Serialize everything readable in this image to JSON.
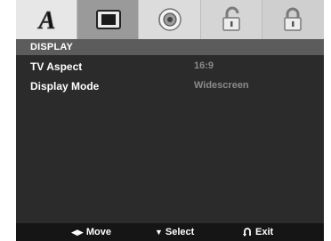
{
  "tabs": [
    {
      "label": "A",
      "icon": "language-icon",
      "active": false
    },
    {
      "label": "",
      "icon": "display-icon",
      "active": true
    },
    {
      "label": "",
      "icon": "speaker-icon",
      "active": false
    },
    {
      "label": "",
      "icon": "unlock-icon",
      "active": false
    },
    {
      "label": "",
      "icon": "lock-icon",
      "active": false
    }
  ],
  "section": {
    "title": "DISPLAY"
  },
  "settings": [
    {
      "label": "TV Aspect",
      "value": "16:9"
    },
    {
      "label": "Display Mode",
      "value": "Widescreen"
    }
  ],
  "footer": {
    "move_icon": "◀▶",
    "move_label": "Move",
    "select_icon": "▼",
    "select_label": "Select",
    "exit_icon": "return-arrow-icon",
    "exit_label": "Exit"
  },
  "colors": {
    "active_tab": "#9a9a9a",
    "panel_bg": "#2b2b2b",
    "header_bg": "#5c5c5c",
    "footer_bg": "#151515",
    "value_text": "#8a8a8a"
  }
}
